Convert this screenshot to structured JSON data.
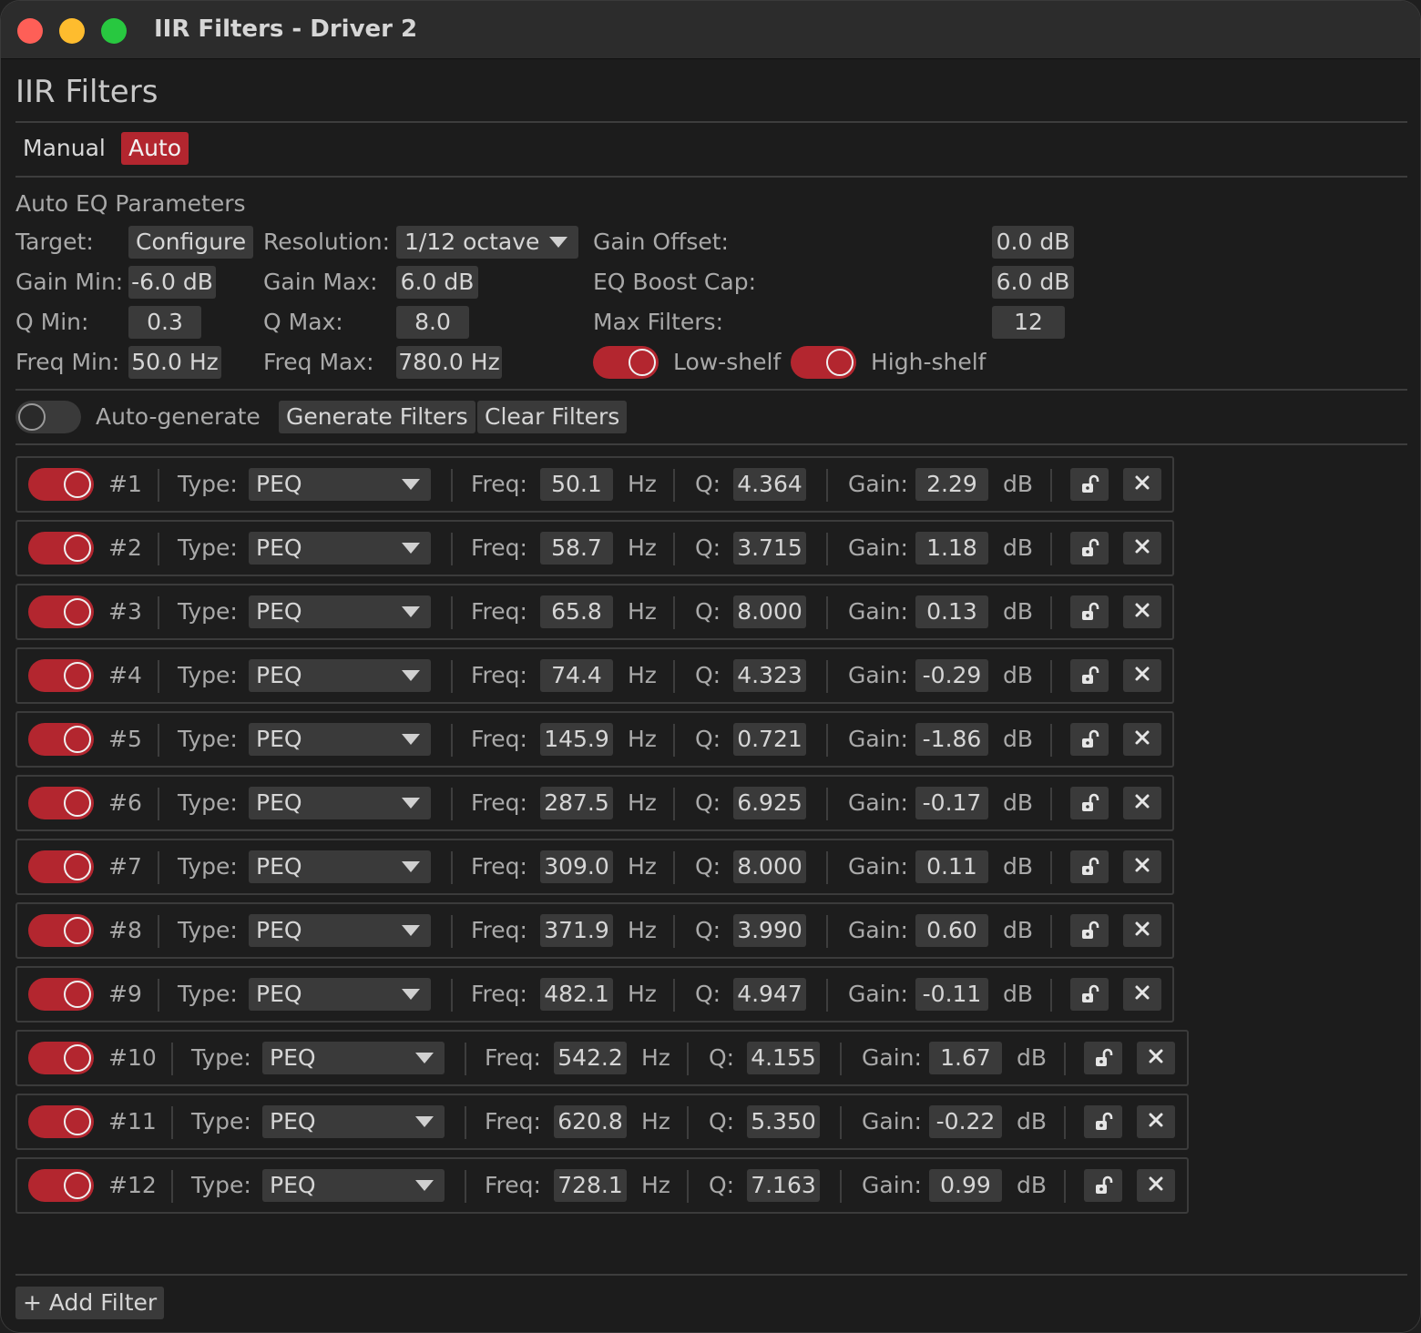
{
  "window": {
    "title": "IIR Filters - Driver 2"
  },
  "header": {
    "title": "IIR Filters"
  },
  "tabs": [
    {
      "label": "Manual"
    },
    {
      "label": "Auto"
    }
  ],
  "auto_eq": {
    "section_title": "Auto EQ Parameters",
    "target_label": "Target:",
    "target_button": "Configure",
    "resolution_label": "Resolution:",
    "resolution_value": "1/12 octave",
    "gain_offset_label": "Gain Offset:",
    "gain_offset_value": "0.0 dB",
    "gain_min_label": "Gain Min:",
    "gain_min_value": "-6.0 dB",
    "gain_max_label": "Gain Max:",
    "gain_max_value": "6.0 dB",
    "eq_boost_cap_label": "EQ Boost Cap:",
    "eq_boost_cap_value": "6.0 dB",
    "q_min_label": "Q Min:",
    "q_min_value": "0.3",
    "q_max_label": "Q Max:",
    "q_max_value": "8.0",
    "max_filters_label": "Max Filters:",
    "max_filters_value": "12",
    "freq_min_label": "Freq Min:",
    "freq_min_value": "50.0 Hz",
    "freq_max_label": "Freq Max:",
    "freq_max_value": "780.0 Hz",
    "low_shelf_label": "Low-shelf",
    "low_shelf_on": true,
    "high_shelf_label": "High-shelf",
    "high_shelf_on": true
  },
  "actions": {
    "auto_generate_label": "Auto-generate",
    "auto_generate_on": false,
    "generate_button": "Generate Filters",
    "clear_button": "Clear Filters"
  },
  "filter_labels": {
    "type": "Type:",
    "freq": "Freq:",
    "hz": "Hz",
    "q": "Q:",
    "gain": "Gain:",
    "db": "dB"
  },
  "filters": [
    {
      "index": "#1",
      "enabled": true,
      "type": "PEQ",
      "freq": "50.1",
      "q": "4.364",
      "gain": "2.29"
    },
    {
      "index": "#2",
      "enabled": true,
      "type": "PEQ",
      "freq": "58.7",
      "q": "3.715",
      "gain": "1.18"
    },
    {
      "index": "#3",
      "enabled": true,
      "type": "PEQ",
      "freq": "65.8",
      "q": "8.000",
      "gain": "0.13"
    },
    {
      "index": "#4",
      "enabled": true,
      "type": "PEQ",
      "freq": "74.4",
      "q": "4.323",
      "gain": "-0.29"
    },
    {
      "index": "#5",
      "enabled": true,
      "type": "PEQ",
      "freq": "145.9",
      "q": "0.721",
      "gain": "-1.86"
    },
    {
      "index": "#6",
      "enabled": true,
      "type": "PEQ",
      "freq": "287.5",
      "q": "6.925",
      "gain": "-0.17"
    },
    {
      "index": "#7",
      "enabled": true,
      "type": "PEQ",
      "freq": "309.0",
      "q": "8.000",
      "gain": "0.11"
    },
    {
      "index": "#8",
      "enabled": true,
      "type": "PEQ",
      "freq": "371.9",
      "q": "3.990",
      "gain": "0.60"
    },
    {
      "index": "#9",
      "enabled": true,
      "type": "PEQ",
      "freq": "482.1",
      "q": "4.947",
      "gain": "-0.11"
    },
    {
      "index": "#10",
      "enabled": true,
      "type": "PEQ",
      "freq": "542.2",
      "q": "4.155",
      "gain": "1.67"
    },
    {
      "index": "#11",
      "enabled": true,
      "type": "PEQ",
      "freq": "620.8",
      "q": "5.350",
      "gain": "-0.22"
    },
    {
      "index": "#12",
      "enabled": true,
      "type": "PEQ",
      "freq": "728.1",
      "q": "7.163",
      "gain": "0.99"
    }
  ],
  "footer": {
    "add_button": "+ Add Filter"
  },
  "colors": {
    "accent": "#b3262f",
    "background": "#1c1c1c",
    "field": "#3a3a3a"
  },
  "icons": {
    "lock": "unlock-icon",
    "remove": "close-icon"
  }
}
